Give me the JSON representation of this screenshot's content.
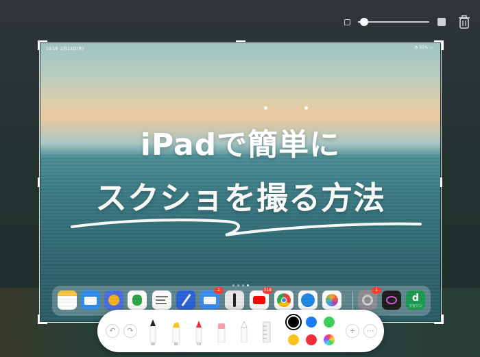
{
  "title": {
    "line1": "iPadで簡単に",
    "line2": "スクショを撮る方法"
  },
  "status_bar": {
    "time": "10:18",
    "date": "2月13日(木)",
    "battery": "55%"
  },
  "top_controls": {
    "size_slider_value": 0.05,
    "small_icon": "small-square-icon",
    "large_icon": "large-square-icon",
    "trash_icon": "trash-icon"
  },
  "dock": {
    "apps": [
      {
        "name": "notes",
        "badge": ""
      },
      {
        "name": "files",
        "badge": ""
      },
      {
        "name": "omnifocus",
        "badge": ""
      },
      {
        "name": "evernote",
        "badge": ""
      },
      {
        "name": "goodnotes",
        "badge": ""
      },
      {
        "name": "pencil-app",
        "badge": ""
      },
      {
        "name": "mail",
        "badge": "2"
      },
      {
        "name": "ink-pen",
        "badge": ""
      },
      {
        "name": "youtube",
        "badge": "318"
      },
      {
        "name": "chrome",
        "badge": ""
      },
      {
        "name": "safari",
        "badge": ""
      },
      {
        "name": "photos",
        "badge": ""
      },
      {
        "name": "settings",
        "badge": "1"
      },
      {
        "name": "procreate",
        "badge": ""
      },
      {
        "name": "d-magazine",
        "badge": "",
        "label": "マガジン"
      }
    ]
  },
  "markup_toolbar": {
    "undo_icon": "undo-icon",
    "redo_icon": "redo-icon",
    "tools": [
      {
        "name": "pen",
        "value": "98"
      },
      {
        "name": "highlighter",
        "value": "80"
      },
      {
        "name": "pencil",
        "value": "50"
      },
      {
        "name": "eraser",
        "value": ""
      },
      {
        "name": "lasso",
        "value": ""
      },
      {
        "name": "ruler",
        "value": ""
      }
    ],
    "colors": [
      "#000000",
      "#1a7cf5",
      "#3ad15a",
      "#f8c31a",
      "#f0303d",
      "rainbow"
    ],
    "selected_color": "#000000",
    "add_icon": "plus-icon",
    "more_icon": "ellipsis-icon"
  }
}
